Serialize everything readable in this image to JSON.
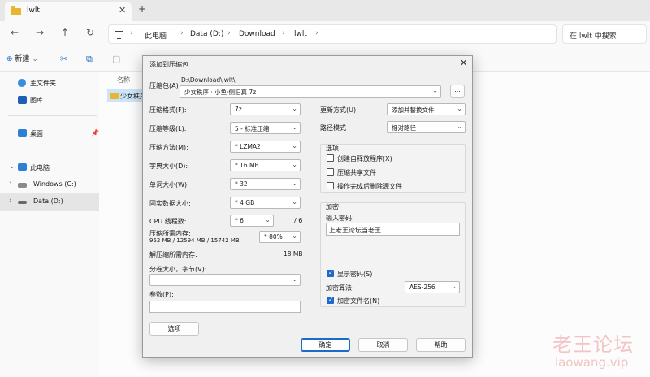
{
  "explorer": {
    "tab_title": "lwlt",
    "tab_close": "✕",
    "new_tab": "+",
    "nav": {
      "back": "←",
      "forward": "→",
      "up": "↑",
      "refresh": "↻"
    },
    "breadcrumbs": [
      "此电脑",
      "Data (D:)",
      "Download",
      "lwlt"
    ],
    "crumb_sep": "›",
    "search_placeholder": "在 lwlt 中搜索",
    "new_label": "新建",
    "sidebar": {
      "items": [
        {
          "label": "主文件夹"
        },
        {
          "label": "图库"
        },
        {
          "label": "桌面"
        },
        {
          "label": "此电脑"
        },
        {
          "label": "Windows (C:)"
        },
        {
          "label": "Data (D:)"
        }
      ]
    },
    "column_name": "名称",
    "file_name": "少女秩序"
  },
  "dialog": {
    "title": "添加到压缩包",
    "close": "✕",
    "archive_label": "压缩包(A)",
    "archive_path": "D:\\Download\\lwlt\\",
    "archive_name": "少女秩序 · 小鱼·侧旧真 7z",
    "browse": "...",
    "format_label": "压缩格式(F):",
    "format_value": "7z",
    "level_label": "压缩等级(L):",
    "level_value": "5 - 标准压缩",
    "method_label": "压缩方法(M):",
    "method_value": "* LZMA2",
    "dict_label": "字典大小(D):",
    "dict_value": "* 16 MB",
    "word_label": "单词大小(W):",
    "word_value": "* 32",
    "solid_label": "固实数据大小:",
    "solid_value": "* 4 GB",
    "cpu_label": "CPU 线程数:",
    "cpu_value": "* 6",
    "cpu_max": "/ 6",
    "mem_label": "压缩所需内存:",
    "mem_detail": "952 MB / 12594 MB / 15742 MB",
    "mem_value": "* 80%",
    "decomp_label": "解压缩所需内存:",
    "decomp_value": "18 MB",
    "split_label": "分卷大小，字节(V):",
    "params_label": "参数(P):",
    "options_button": "选项",
    "update_label": "更新方式(U):",
    "update_value": "添加并替换文件",
    "path_label": "路径模式",
    "path_value": "相对路径",
    "options_group": "选项",
    "opt_sfx": "创建自释放程序(X)",
    "opt_shared": "压缩共享文件",
    "opt_delete": "操作完成后删除源文件",
    "encrypt_group": "加密",
    "password_label": "输入密码:",
    "password_value": "上老王论坛当老王",
    "show_password": "显示密码(S)",
    "enc_method_label": "加密算法:",
    "enc_method_value": "AES-256",
    "encrypt_names": "加密文件名(N)",
    "ok": "确定",
    "cancel": "取消",
    "help": "帮助"
  },
  "watermark": {
    "line1": "老王论坛",
    "line2": "laowang.vip"
  }
}
